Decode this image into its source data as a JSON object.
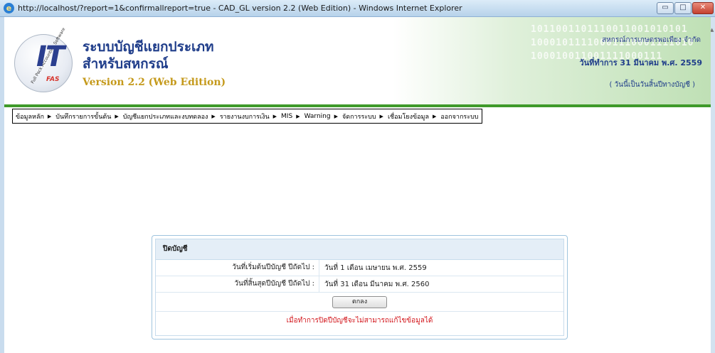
{
  "window": {
    "title": "http://localhost/?report=1&confirmallreport=true - CAD_GL version 2.2 (Web Edition) - Windows Internet Explorer",
    "min_label": "▭",
    "max_label": "□",
    "close_label": "✕"
  },
  "header": {
    "logo_text": "IT",
    "logo_fas": "FAS",
    "logo_ring": "Full Pack Accounting Software",
    "title_line1": "ระบบบัญชีแยกประเภท",
    "title_line2": "สำหรับสหกรณ์",
    "version": "Version 2.2 (Web Edition)",
    "binary": "1011001101110011001010101\n10001011110001110001111010\n100010011001111000111",
    "coop_name": "สหกรณ์การเกษตรพอเพียง จำกัด",
    "workday": "วันที่ทำการ 31 มีนาคม พ.ศ. 2559",
    "period_note": "( วันนี้เป็นวันสิ้นปีทางบัญชี )"
  },
  "menu": {
    "items": [
      {
        "label": "ข้อมูลหลัก"
      },
      {
        "label": "บันทึกรายการขั้นต้น"
      },
      {
        "label": "บัญชีแยกประเภทและงบทดลอง"
      },
      {
        "label": "รายงานงบการเงิน"
      },
      {
        "label": "MIS"
      },
      {
        "label": "Warning"
      },
      {
        "label": "จัดการระบบ"
      },
      {
        "label": "เชื่อมโยงข้อมูล"
      },
      {
        "label": "ออกจากระบบ"
      }
    ],
    "arrow": "▶"
  },
  "panel": {
    "title": "ปิดบัญชี",
    "rows": [
      {
        "label": "วันที่เริ่มต้นปีบัญชี ปีถัดไป :",
        "value": "วันที่ 1 เดือน เมษายน พ.ศ. 2559"
      },
      {
        "label": "วันที่สิ้นสุดปีบัญชี ปีถัดไป :",
        "value": "วันที่ 31 เดือน มีนาคม พ.ศ. 2560"
      }
    ],
    "ok_label": "ตกลง",
    "warning": "เมื่อทำการปิดปีบัญชีจะไม่สามารถแก้ไขข้อมูลได้"
  },
  "colors": {
    "accent_green": "#3f9a2a",
    "title_blue": "#1f3d8a",
    "version_gold": "#c59a1c",
    "warning_red": "#d2141a"
  }
}
